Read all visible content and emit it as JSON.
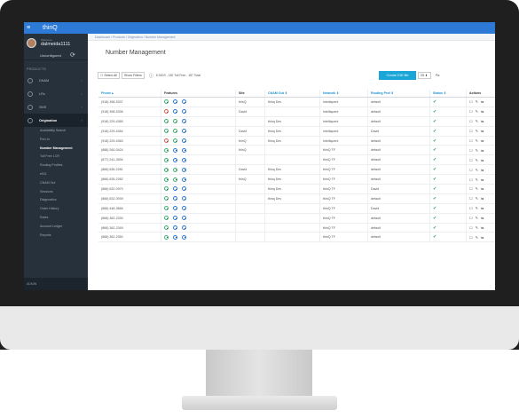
{
  "app": {
    "brand": "thinQ",
    "menu_icon": "hamburger-icon"
  },
  "sidebar": {
    "welcome": "Welcome,",
    "username": "dalmeida1111",
    "status": "Unconfigured",
    "products_label": "PRODUCTS",
    "items": [
      {
        "label": "DNAM"
      },
      {
        "label": "LRs"
      },
      {
        "label": "SMS"
      },
      {
        "label": "Origination"
      }
    ],
    "subitems": [
      {
        "label": "Availability Search"
      },
      {
        "label": "Port-In"
      },
      {
        "label": "Number Management"
      },
      {
        "label": "Toll Free LCR"
      },
      {
        "label": "Routing Profiles"
      },
      {
        "label": "e911"
      },
      {
        "label": "CNAM Out"
      },
      {
        "label": "Sessions"
      },
      {
        "label": "Diagnostics"
      },
      {
        "label": "Order History"
      },
      {
        "label": "Rates"
      },
      {
        "label": "Account Ledger"
      },
      {
        "label": "Reports"
      }
    ],
    "admin_label": "ADMIN"
  },
  "breadcrumb": "Dashboard  /  Products  /  Origination  /  Number Management",
  "page_title": "Number Management",
  "toolbar": {
    "select_all": "Select All",
    "show_filters": "Show Filters",
    "summary": "5 DIDS - 182 Toll Free - 187 Total",
    "create_label": "Create DID file",
    "per_page": "25",
    "page_label": "Pa"
  },
  "table": {
    "headers": [
      "Phone",
      "Features",
      "Site",
      "CNAM Out",
      "Network",
      "Routing Prof",
      "Status",
      "Actions"
    ],
    "rows": [
      {
        "phone": "(918) 398-5337",
        "site": "thinQ",
        "cnam": "thinq Dev",
        "network": "Intelliquent",
        "routing": "default",
        "f": [
          "g",
          "b",
          "b"
        ]
      },
      {
        "phone": "(918) 398-5336",
        "site": "David",
        "cnam": "",
        "network": "Intelliquent",
        "routing": "default",
        "f": [
          "r",
          "b",
          "b"
        ]
      },
      {
        "phone": "(918) 229-4365",
        "site": "",
        "cnam": "thinq Dev",
        "network": "Intelliquent",
        "routing": "default",
        "f": [
          "g",
          "g",
          "b"
        ]
      },
      {
        "phone": "(918) 229-4364",
        "site": "David",
        "cnam": "thinq Dev",
        "network": "Intelliquent",
        "routing": "David",
        "f": [
          "g",
          "g",
          "b"
        ]
      },
      {
        "phone": "(918) 229-4363",
        "site": "thinQ",
        "cnam": "thinq Dev",
        "network": "Intelliquent",
        "routing": "default",
        "f": [
          "r",
          "g",
          "b"
        ]
      },
      {
        "phone": "(888) 260-0424",
        "site": "thinQ",
        "cnam": "",
        "network": "thinQ TF",
        "routing": "default",
        "f": [
          "g",
          "b",
          "b"
        ]
      },
      {
        "phone": "(877) 241-3594",
        "site": "",
        "cnam": "",
        "network": "thinQ TF",
        "routing": "default",
        "f": [
          "g",
          "b",
          "b"
        ]
      },
      {
        "phone": "(866) 635-2281",
        "site": "David",
        "cnam": "thinq Dev",
        "network": "thinQ TF",
        "routing": "default",
        "f": [
          "g",
          "g",
          "b"
        ]
      },
      {
        "phone": "(866) 635-2282",
        "site": "thinQ",
        "cnam": "thinq Dev",
        "network": "thinQ TF",
        "routing": "default",
        "f": [
          "g",
          "g",
          "b"
        ]
      },
      {
        "phone": "(866) 632-0970",
        "site": "",
        "cnam": "thinq Dev",
        "network": "thinQ TF",
        "routing": "David",
        "f": [
          "g",
          "b",
          "b"
        ]
      },
      {
        "phone": "(866) 632-0939",
        "site": "",
        "cnam": "thinq Dev",
        "network": "thinQ TF",
        "routing": "default",
        "f": [
          "g",
          "b",
          "b"
        ]
      },
      {
        "phone": "(866) 448-3666",
        "site": "",
        "cnam": "",
        "network": "thinQ TF",
        "routing": "David",
        "f": [
          "g",
          "b",
          "b"
        ]
      },
      {
        "phone": "(866) 362-2330",
        "site": "",
        "cnam": "",
        "network": "thinQ TF",
        "routing": "default",
        "f": [
          "g",
          "b",
          "b"
        ]
      },
      {
        "phone": "(866) 362-2349",
        "site": "",
        "cnam": "",
        "network": "thinQ TF",
        "routing": "default",
        "f": [
          "g",
          "b",
          "b"
        ]
      },
      {
        "phone": "(866) 362-2350",
        "site": "",
        "cnam": "",
        "network": "thinQ TF",
        "routing": "default",
        "f": [
          "g",
          "b",
          "b"
        ]
      }
    ]
  },
  "colors": {
    "topbar": "#2d7ad6",
    "sidebar": "#26313b",
    "accent": "#1aa6d6",
    "status_ok": "#2ca36b"
  }
}
